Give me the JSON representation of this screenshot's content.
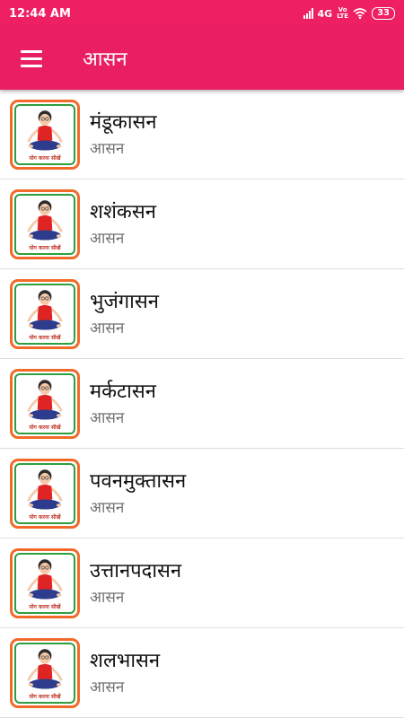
{
  "status_bar": {
    "time": "12:44 AM",
    "network": "4G",
    "volte_top": "Vo",
    "volte_bottom": "LTE",
    "battery": "33"
  },
  "app_bar": {
    "title": "आसन",
    "menu_icon": "hamburger-menu-icon"
  },
  "colors": {
    "primary": "#e91e63",
    "status_bar": "#ef1f63",
    "thumb_border_outer": "#f26a2a",
    "thumb_border_inner": "#2e9e3e"
  },
  "list": {
    "thumb_caption": "योग करना सीखें",
    "items": [
      {
        "title": "मंडूकासन",
        "subtitle": "आसन"
      },
      {
        "title": "शशंकसन",
        "subtitle": "आसन"
      },
      {
        "title": "भुजंगासन",
        "subtitle": "आसन"
      },
      {
        "title": "मर्कटासन",
        "subtitle": "आसन"
      },
      {
        "title": "पवनमुक्तासन",
        "subtitle": "आसन"
      },
      {
        "title": "उत्तानपदासन",
        "subtitle": "आसन"
      },
      {
        "title": "शलभासन",
        "subtitle": "आसन"
      }
    ]
  }
}
